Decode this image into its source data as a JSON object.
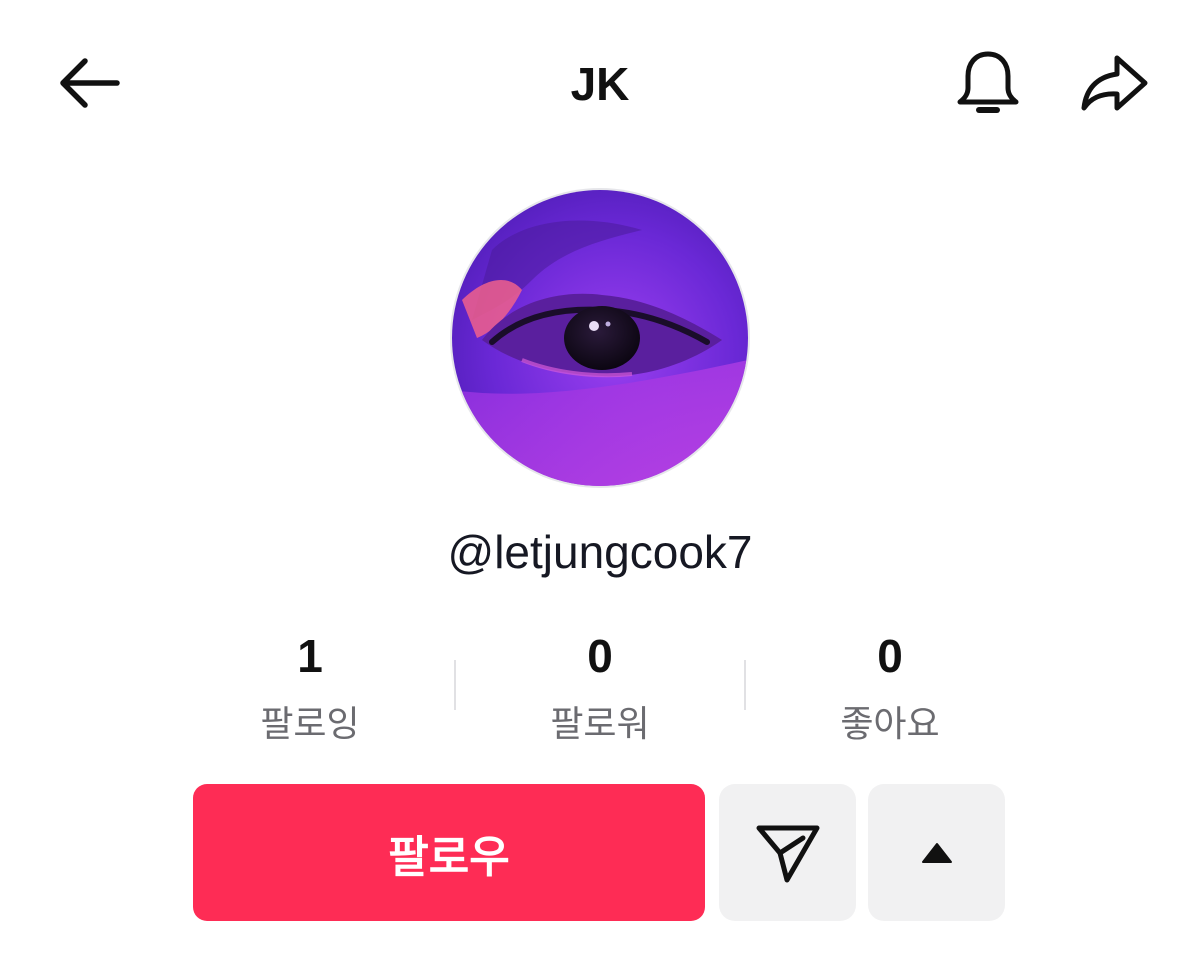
{
  "header": {
    "title": "JK",
    "back_icon": "arrow-left-icon",
    "notification_icon": "bell-icon",
    "share_icon": "share-arrow-icon"
  },
  "profile": {
    "handle": "@letjungcook7",
    "avatar_icon": "profile-photo-eye"
  },
  "stats": [
    {
      "value": "1",
      "label": "팔로잉"
    },
    {
      "value": "0",
      "label": "팔로워"
    },
    {
      "value": "0",
      "label": "좋아요"
    }
  ],
  "actions": {
    "follow_label": "팔로우",
    "message_icon": "paper-plane-icon",
    "more_icon": "caret-up-icon"
  },
  "colors": {
    "follow_button": "#fe2c55",
    "secondary_button": "#f1f1f2",
    "text_primary": "#161823",
    "text_secondary": "#6b6b70"
  }
}
